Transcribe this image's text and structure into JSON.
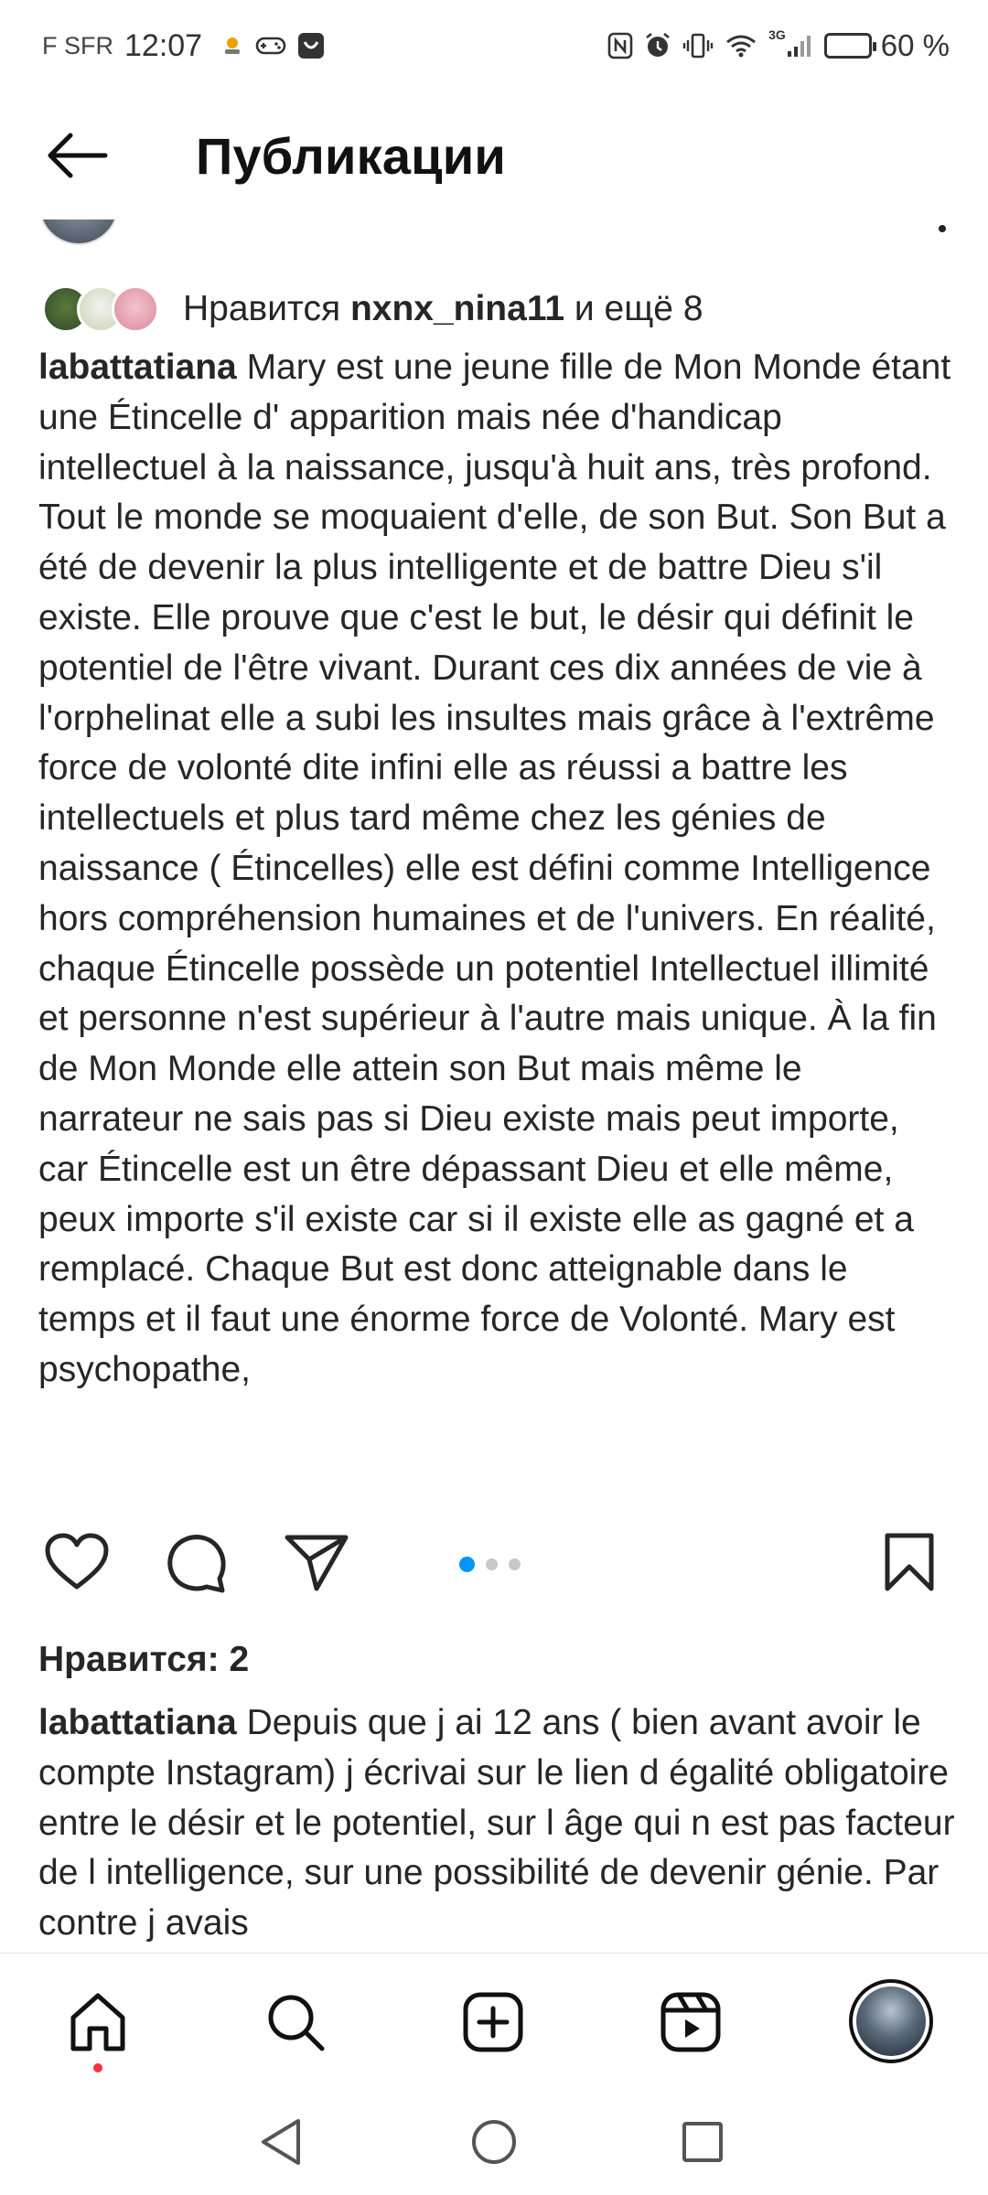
{
  "status_bar": {
    "carrier": "F SFR",
    "time": "12:07",
    "network": "3G",
    "battery_percent": "60 %",
    "battery_level": 0.6,
    "icons": [
      "weather-icon",
      "game-controller-icon",
      "app-notification-icon",
      "nfc-icon",
      "alarm-icon",
      "vibrate-icon",
      "wifi-icon",
      "signal-icon",
      "battery-icon"
    ]
  },
  "header": {
    "title": "Публикации",
    "back_icon": "arrow-left-icon"
  },
  "post": {
    "likes_prefix": "Нравится ",
    "likes_user": "nxnx_nina11",
    "likes_suffix": " и ещё 8",
    "caption_user": "labattatiana",
    "caption_text": " Mary est une jeune fille de Mon Monde étant une Étincelle d' apparition mais née d'handicap intellectuel à la naissance, jusqu'à huit ans, très profond. Tout le monde se moquaient d'elle, de son But.  Son But a été de devenir la plus intelligente et de battre Dieu s'il existe. Elle prouve que c'est le but, le désir qui définit le potentiel de l'être vivant. Durant ces dix années de vie à l'orphelinat elle a subi les insultes mais grâce à l'extrême force de volonté dite infini elle as réussi a battre les intellectuels et plus tard même chez les génies de naissance ( Étincelles) elle est défini comme Intelligence hors compréhension humaines et de l'univers. En réalité, chaque Étincelle possède un potentiel Intellectuel illimité et personne n'est supérieur à l'autre mais unique. À la fin de Mon Monde elle attein son But mais même le narrateur ne sais pas si Dieu existe mais peut importe, car Étincelle est un être dépassant Dieu et elle même, peux importe s'il existe car si il existe elle as gagné et a remplacé. Chaque But est donc atteignable dans le temps et il faut une énorme force de Volonté. Mary est psychopathe,",
    "carousel": {
      "count": 3,
      "active_index": 0
    },
    "likes_count": "Нравится: 2",
    "comment_user": "labattatiana",
    "comment_text": " Depuis que j ai 12 ans ( bien avant avoir le compte Instagram) j écrivai sur le lien d égalité obligatoire entre le désir et le potentiel, sur l âge qui n est pas facteur de l intelligence, sur une possibilité de devenir génie. Par contre j avais"
  },
  "bottom_nav": {
    "items": [
      "home-icon",
      "search-icon",
      "create-icon",
      "reels-icon",
      "profile-avatar"
    ],
    "notification_color": "#ff3040"
  },
  "colors": {
    "accent": "#0095f6",
    "text": "#262626"
  }
}
